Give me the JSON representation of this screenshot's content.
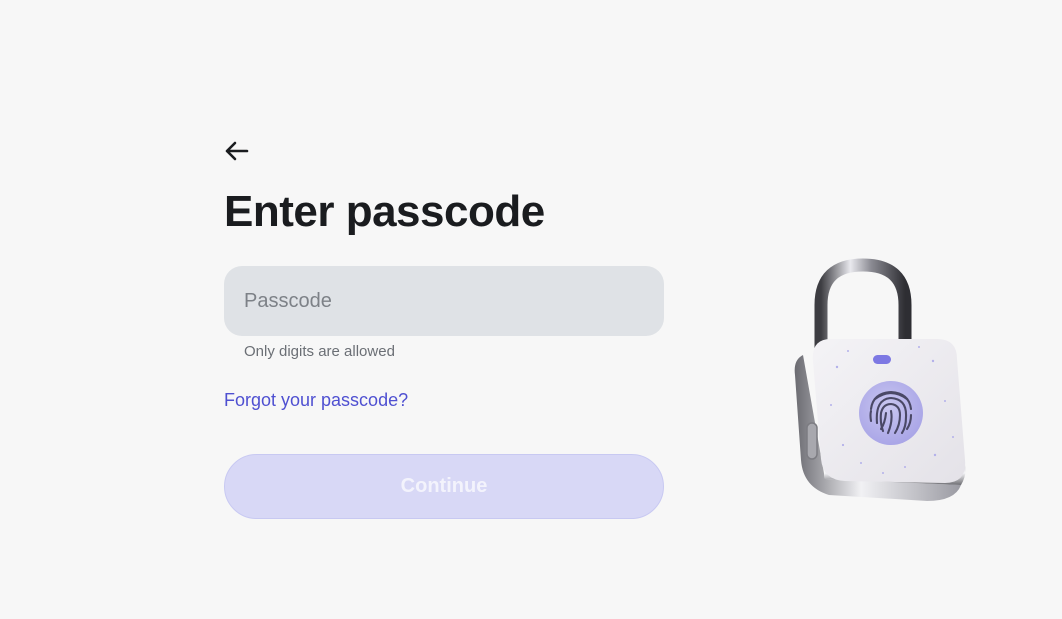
{
  "header": {
    "back_icon": "arrow-left-icon",
    "title": "Enter passcode"
  },
  "form": {
    "passcode": {
      "placeholder": "Passcode",
      "value": "",
      "hint": "Only digits are allowed"
    },
    "forgot_link": "Forgot your passcode?",
    "continue_label": "Continue",
    "continue_disabled": true
  },
  "illustration": {
    "icon": "fingerprint-padlock-icon"
  },
  "colors": {
    "background": "#f7f7f7",
    "accent": "#4f50d1",
    "input_bg": "#dfe2e6",
    "button_disabled_bg": "#d8d8f6",
    "title": "#1a1c1f"
  }
}
